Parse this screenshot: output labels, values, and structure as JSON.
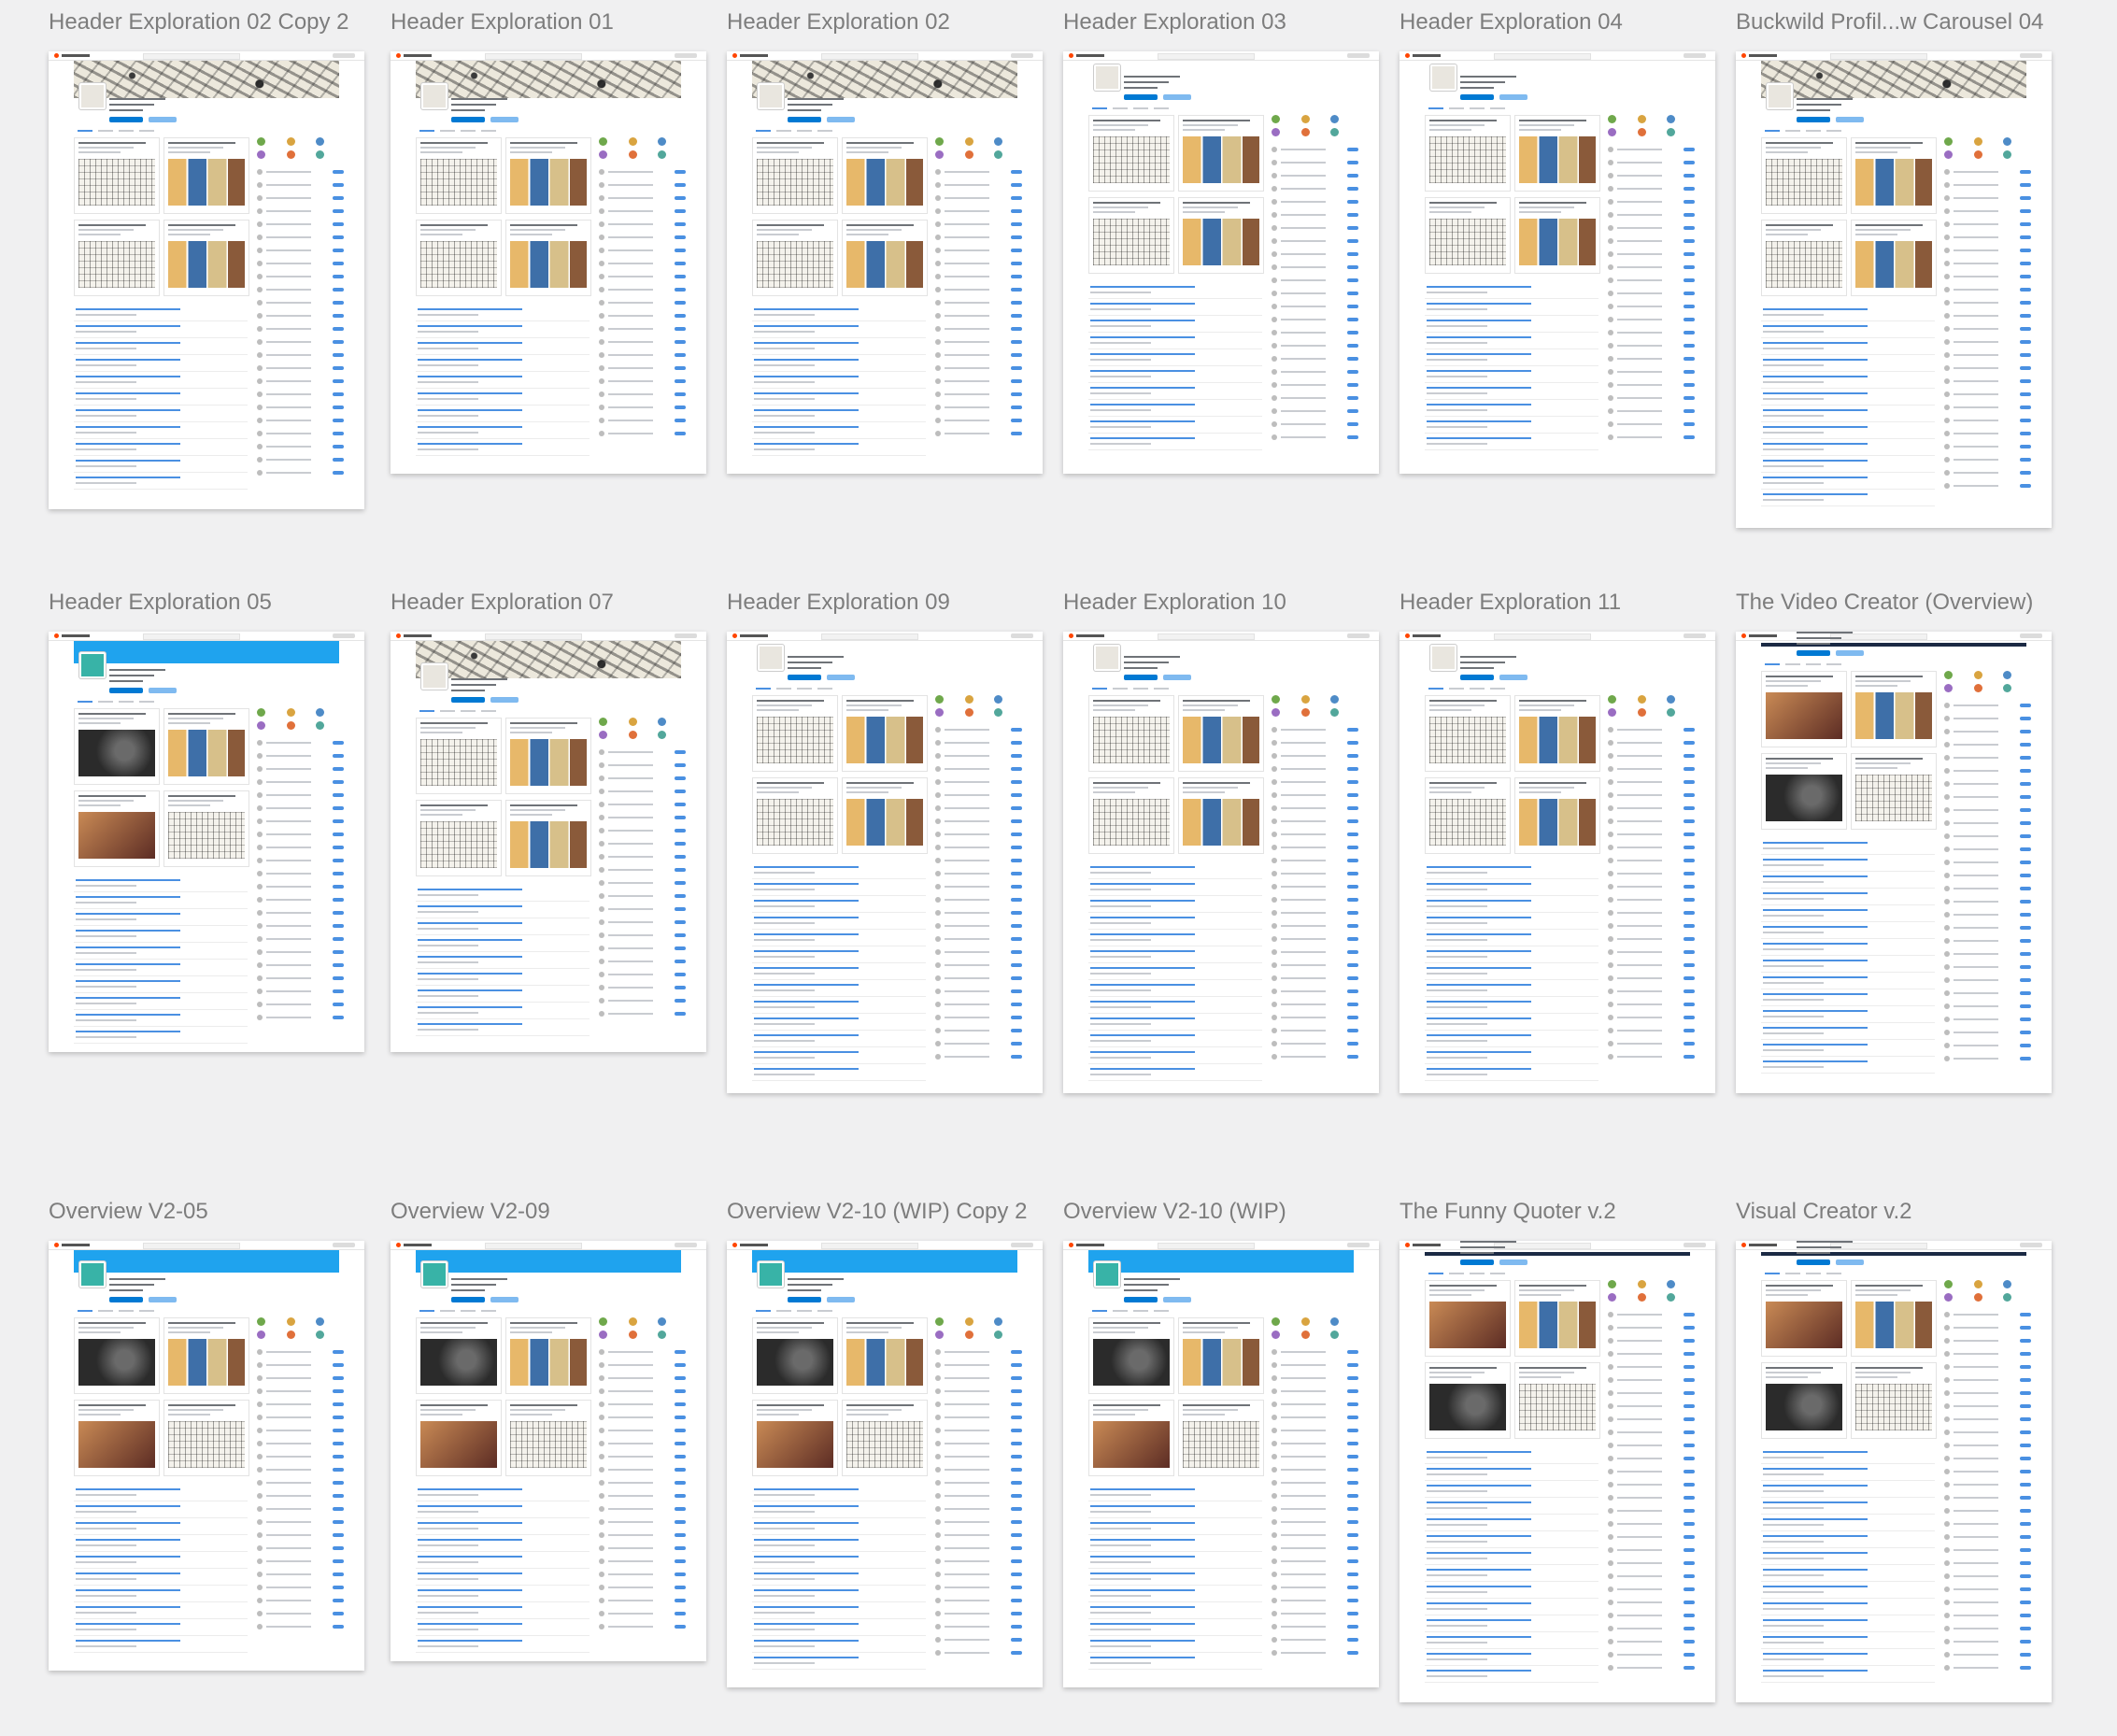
{
  "artboards": [
    {
      "title": "Header Exploration 02 Copy 2",
      "variant": "comic-header"
    },
    {
      "title": "Header Exploration 01",
      "variant": "comic-header"
    },
    {
      "title": "Header Exploration 02",
      "variant": "comic-header"
    },
    {
      "title": "Header Exploration 03",
      "variant": "plain-header"
    },
    {
      "title": "Header Exploration 04",
      "variant": "plain-header"
    },
    {
      "title": "Buckwild Profil...w Carousel 04",
      "variant": "comic-header"
    },
    {
      "title": "Header Exploration 05",
      "variant": "blue-header"
    },
    {
      "title": "Header Exploration 07",
      "variant": "comic-header"
    },
    {
      "title": "Header Exploration 09",
      "variant": "plain-header"
    },
    {
      "title": "Header Exploration 10",
      "variant": "plain-header"
    },
    {
      "title": "Header Exploration 11",
      "variant": "plain-header"
    },
    {
      "title": "The Video Creator (Overview)",
      "variant": "video"
    },
    {
      "title": "Overview V2-05",
      "variant": "blue-header"
    },
    {
      "title": "Overview V2-09",
      "variant": "blue-header"
    },
    {
      "title": "Overview V2-10 (WIP) Copy 2",
      "variant": "blue-header"
    },
    {
      "title": "Overview V2-10 (WIP)",
      "variant": "blue-header"
    },
    {
      "title": "The Funny Quoter v.2",
      "variant": "video"
    },
    {
      "title": "Visual Creator v.2",
      "variant": "video"
    }
  ],
  "colors": {
    "canvas_bg": "#f0f0f1",
    "title_text": "#7d7d7d",
    "reddit_orange": "#ff4500",
    "banner_blue": "#1fa3ee",
    "link_blue": "#4a90e2"
  }
}
